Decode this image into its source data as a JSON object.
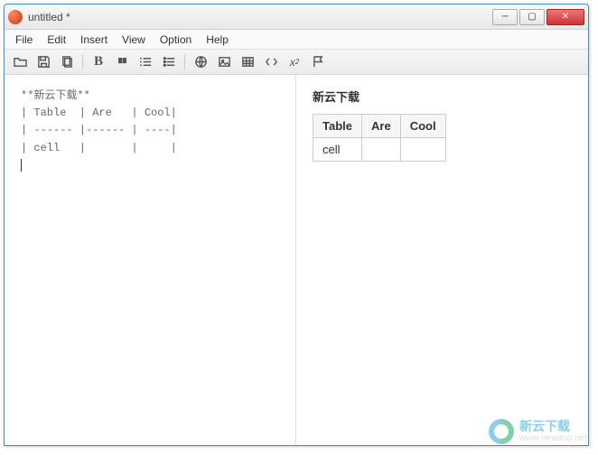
{
  "window": {
    "title": "untitled *"
  },
  "menu": {
    "file": "File",
    "edit": "Edit",
    "insert": "Insert",
    "view": "View",
    "option": "Option",
    "help": "Help"
  },
  "editor": {
    "line1": "**新云下载**",
    "line2": "| Table  | Are   | Cool|",
    "line3": "| ------ |------ | ----|",
    "line4": "| cell   |       |     |"
  },
  "preview": {
    "heading": "新云下载",
    "th1": "Table",
    "th2": "Are",
    "th3": "Cool",
    "td1": "cell",
    "td2": "",
    "td3": ""
  },
  "watermark": {
    "cn": "新云下载",
    "url": "www.newasp.net"
  }
}
